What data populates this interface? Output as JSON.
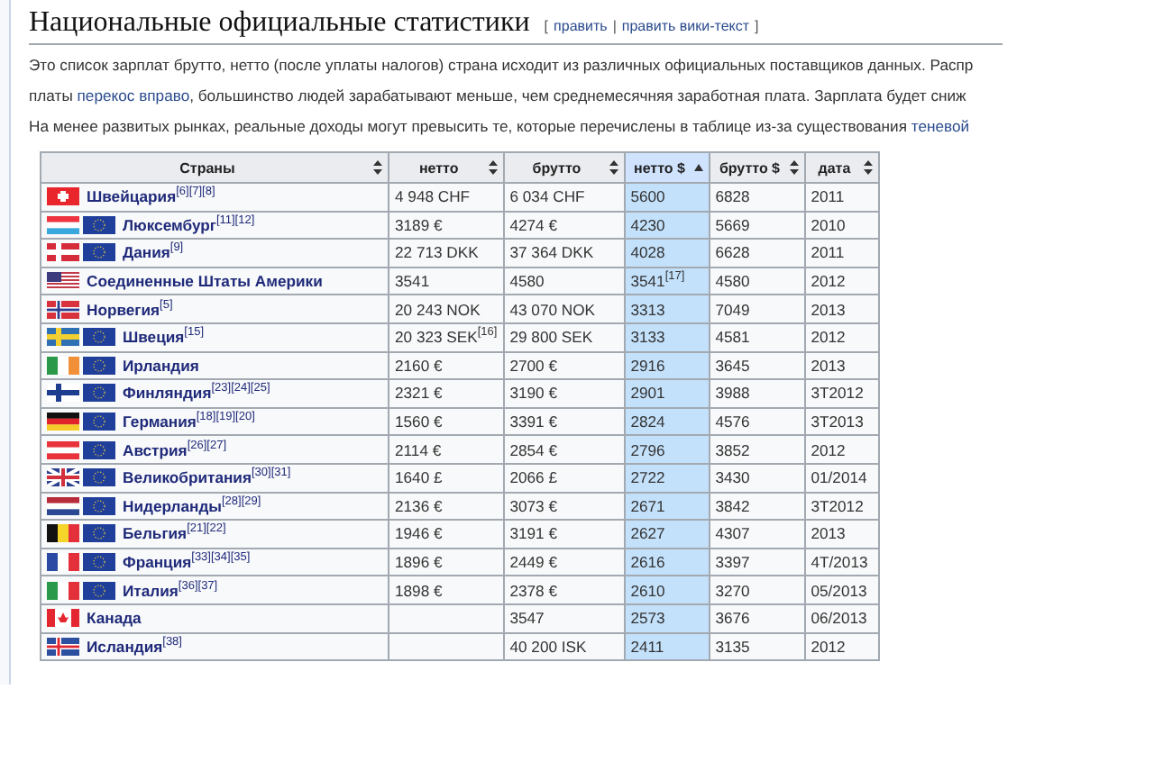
{
  "heading": {
    "title": "Национальные официальные статистики",
    "edit": {
      "open": "[",
      "links": [
        "править",
        "править вики-текст"
      ],
      "separator": "|",
      "close": "]"
    }
  },
  "intro_lines": [
    [
      {
        "text": "Это список зарплат брутто, нетто (после уплаты налогов) страна исходит из различных официальных поставщиков данных. Распр",
        "link": false
      }
    ],
    [
      {
        "text": "платы ",
        "link": false
      },
      {
        "text": "перекос вправо",
        "link": true
      },
      {
        "text": ", большинство людей зарабатывают меньше, чем среднемесячняя заработная плата. Зарплата будет сниж",
        "link": false
      }
    ],
    [
      {
        "text": "На менее развитых рынках, реальные доходы могут превысить те, которые перечислены в таблице из-за существования ",
        "link": false
      },
      {
        "text": "теневой",
        "link": true
      }
    ]
  ],
  "table": {
    "columns": [
      {
        "label": "Страны",
        "sorted": false
      },
      {
        "label": "нетто",
        "sorted": false
      },
      {
        "label": "брутто",
        "sorted": false
      },
      {
        "label": "нетто $",
        "sorted": true
      },
      {
        "label": "брутто $",
        "sorted": false
      },
      {
        "label": "дата",
        "sorted": false
      }
    ],
    "rows": [
      {
        "eu": false,
        "cells": [
          "Швейцария$^{[6][7][8]}$",
          "4 948 CHF",
          "6 034 CHF",
          "5600",
          "6828",
          "2011"
        ]
      },
      {
        "eu": true,
        "cells": [
          "Люксембург$^{[11][12]}$",
          "3189 €",
          "4274 €",
          "4230",
          "5669",
          "2010"
        ]
      },
      {
        "eu": true,
        "cells": [
          "Дания$^{[9]}$",
          "22 713 DKK",
          "37 364 DKK",
          "4028",
          "6628",
          "2011"
        ]
      },
      {
        "eu": false,
        "cells": [
          "Соединенные Штаты Америки",
          "3541",
          "4580",
          "3541$^{[17]}$",
          "4580",
          "2012"
        ]
      },
      {
        "eu": false,
        "cells": [
          "Норвегия$^{[5]}$",
          "20 243 NOK",
          "43 070 NOK",
          "3313",
          "7049",
          "2013"
        ]
      },
      {
        "eu": true,
        "cells": [
          "Швеция$^{[15]}$",
          "20 323 SEK$^{[16]}$",
          "29 800 SEK",
          "3133",
          "4581",
          "2012"
        ]
      },
      {
        "eu": true,
        "cells": [
          "Ирландия",
          "2160 €",
          "2700 €",
          "2916",
          "3645",
          "2013"
        ]
      },
      {
        "eu": true,
        "cells": [
          "Финляндия$^{[23][24][25]}$",
          "2321 €",
          "3190 €",
          "2901",
          "3988",
          "3T2012"
        ]
      },
      {
        "eu": true,
        "cells": [
          "Германия$^{[18][19][20]}$",
          "1560 €",
          "3391 €",
          "2824",
          "4576",
          "3T2013"
        ]
      },
      {
        "eu": true,
        "cells": [
          "Австрия$^{[26][27]}$",
          "2114 €",
          "2854 €",
          "2796",
          "3852",
          "2012"
        ]
      },
      {
        "eu": true,
        "cells": [
          "Великобритания$^{[30][31]}$",
          "1640 £",
          "2066 £",
          "2722",
          "3430",
          "01/2014"
        ]
      },
      {
        "eu": true,
        "cells": [
          "Нидерланды$^{[28][29]}$",
          "2136 €",
          "3073 €",
          "2671",
          "3842",
          "3T2012"
        ]
      },
      {
        "eu": true,
        "cells": [
          "Бельгия$^{[21][22]}$",
          "1946 €",
          "3191 €",
          "2627",
          "4307",
          "2013"
        ]
      },
      {
        "eu": true,
        "cells": [
          "Франция$^{[33][34][35]}$",
          "1896 €",
          "2449 €",
          "2616",
          "3397",
          "4T/2013"
        ]
      },
      {
        "eu": true,
        "cells": [
          "Италия$^{[36][37]}$",
          "1898 €",
          "2378 €",
          "2610",
          "3270",
          "05/2013"
        ]
      },
      {
        "eu": false,
        "cells": [
          "Канада",
          "",
          "3547",
          "2573",
          "3676",
          "06/2013"
        ]
      },
      {
        "eu": false,
        "cells": [
          "Исландия$^{[38]}$",
          "",
          "40 200 ISK",
          "2411",
          "3135",
          "2012"
        ]
      }
    ]
  }
}
